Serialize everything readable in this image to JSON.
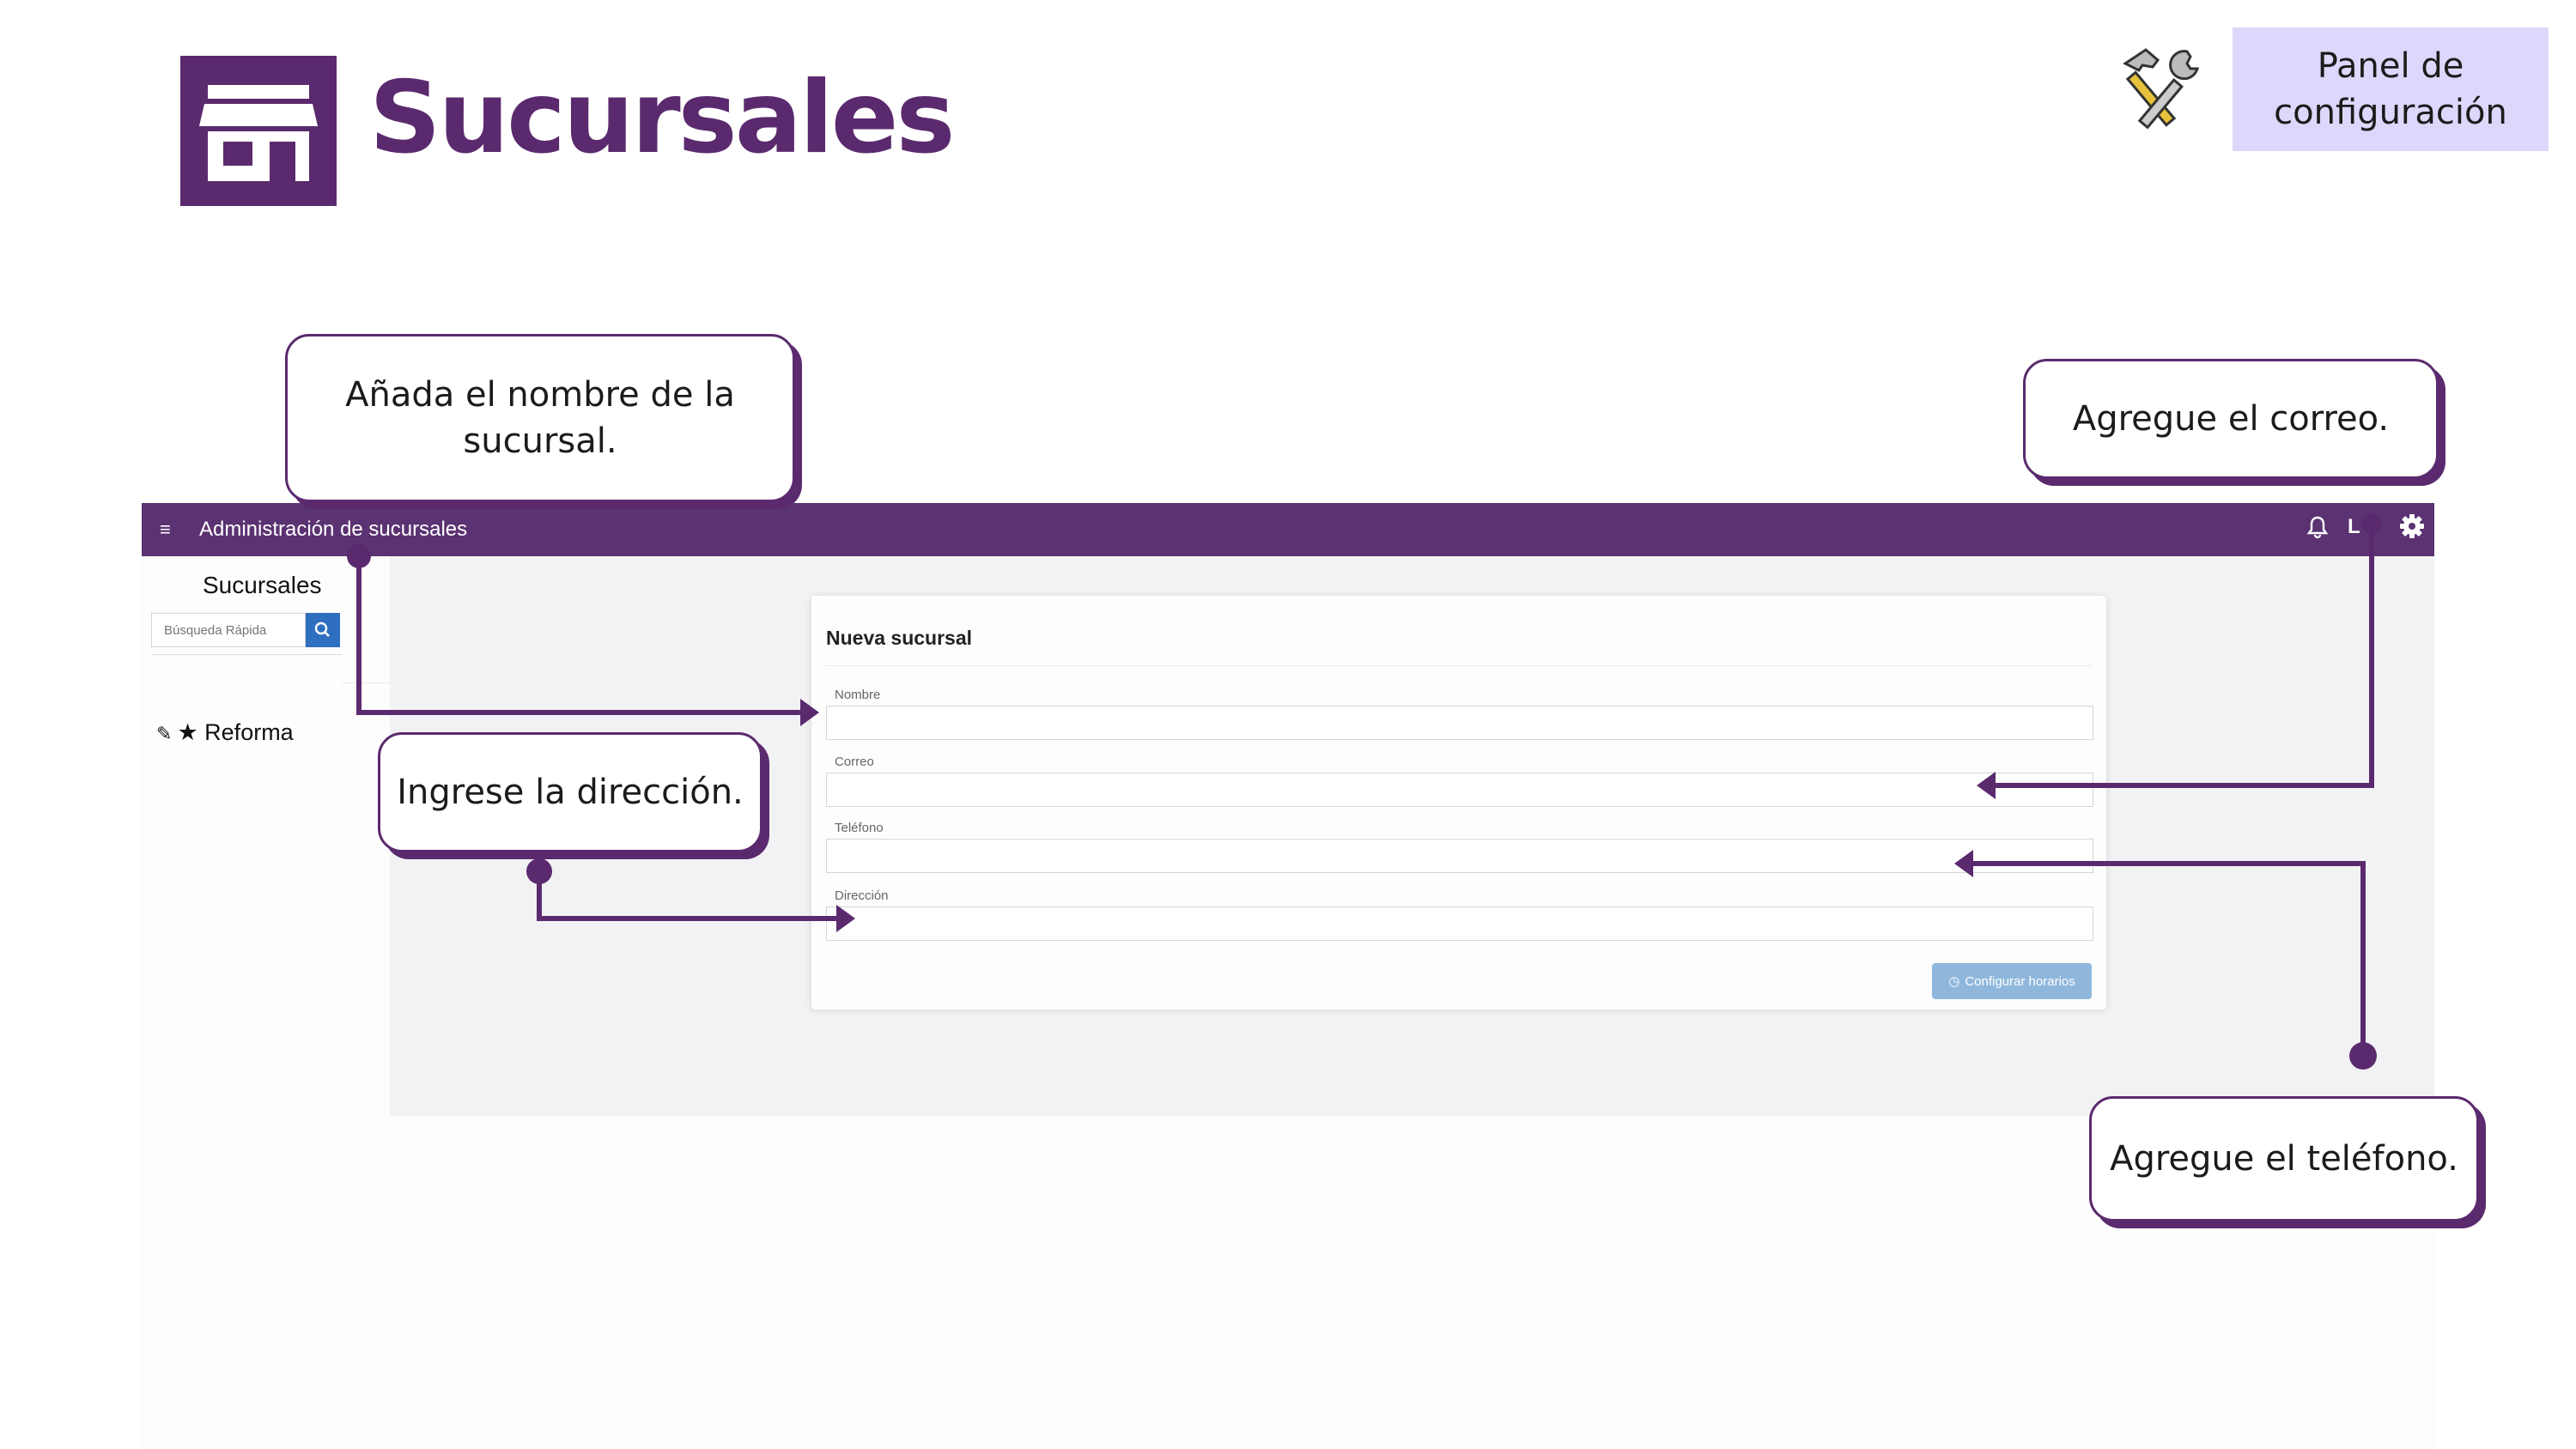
{
  "header": {
    "title": "Sucursales",
    "logo_icon": "store-icon",
    "tools_icon": "hammer-wrench-icon",
    "config_panel_label": "Panel de configuración",
    "brand_color": "#5b2a6e",
    "panel_color": "#dcd8fb"
  },
  "app": {
    "topbar_title": "Administración de sucursales",
    "topbar_color": "#5b3272",
    "icons": [
      "menu-icon",
      "bell-icon",
      "user-icon",
      "gear-icon"
    ],
    "user_glyph": "L"
  },
  "sidebar": {
    "title": "Sucursales",
    "search_placeholder": "Búsqueda Rápida",
    "items": [
      {
        "label": "Reforma",
        "icons": [
          "pencil-icon",
          "star-icon"
        ]
      }
    ]
  },
  "form": {
    "title": "Nueva sucursal",
    "fields": [
      {
        "label": "Nombre",
        "value": ""
      },
      {
        "label": "Correo",
        "value": ""
      },
      {
        "label": "Teléfono",
        "value": ""
      },
      {
        "label": "Dirección",
        "value": ""
      }
    ],
    "button_label": "Configurar horarios",
    "button_color": "#8fb7dc"
  },
  "callouts": {
    "nombre": "Añada el nombre de la sucursal.",
    "correo": "Agregue el correo.",
    "direccion": "Ingrese la dirección.",
    "telefono": "Agregue el teléfono."
  }
}
